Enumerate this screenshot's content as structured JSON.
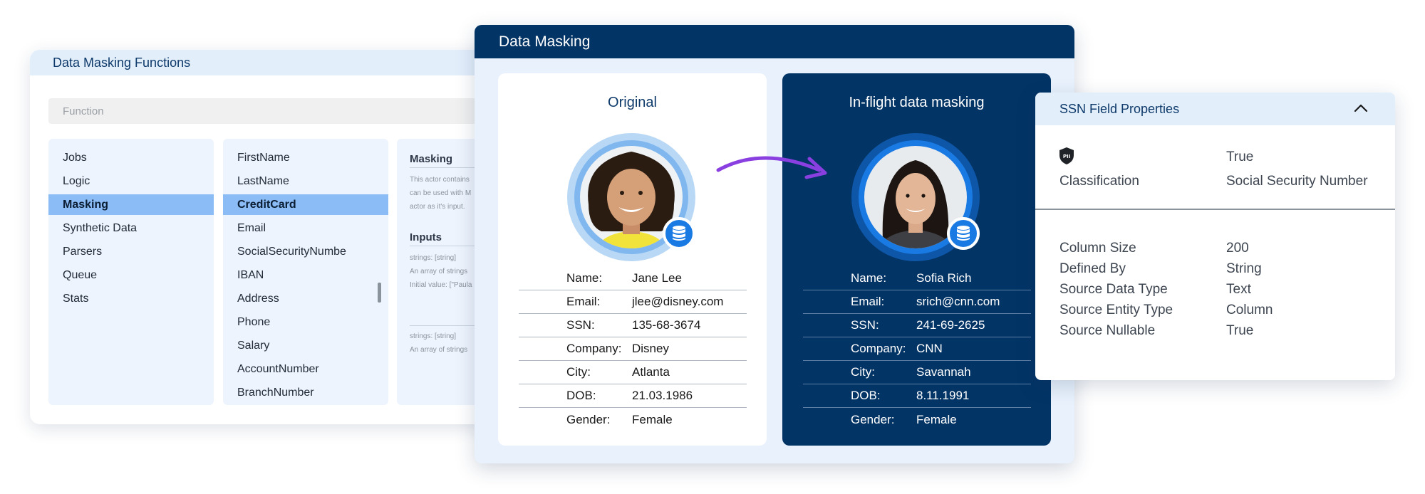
{
  "functions_panel": {
    "title": "Data Masking Functions",
    "search_placeholder": "Function",
    "categories": [
      "Jobs",
      "Logic",
      "Masking",
      "Synthetic Data",
      "Parsers",
      "Queue",
      "Stats"
    ],
    "selected_category": "Masking",
    "functions": [
      "FirstName",
      "LastName",
      "CreditCard",
      "Email",
      "SocialSecurityNumbe",
      "IBAN",
      "Address",
      "Phone",
      "Salary",
      "AccountNumber",
      "BranchNumber"
    ],
    "selected_function": "CreditCard",
    "detail": {
      "title": "Masking",
      "description_lines": [
        "This actor contains",
        "can be used with M",
        "actor as it's input."
      ],
      "inputs_title": "Inputs",
      "input1_lines": [
        "strings: [string]",
        "An array of strings",
        "Initial value: [\"Paula"
      ],
      "input2_lines": [
        "strings: [string]",
        "An array of strings"
      ]
    }
  },
  "masking_panel": {
    "title": "Data Masking",
    "original": {
      "title": "Original",
      "fields": [
        {
          "label": "Name:",
          "value": "Jane Lee"
        },
        {
          "label": "Email:",
          "value": "jlee@disney.com"
        },
        {
          "label": "SSN:",
          "value": "135-68-3674"
        },
        {
          "label": "Company:",
          "value": "Disney"
        },
        {
          "label": "City:",
          "value": "Atlanta"
        },
        {
          "label": "DOB:",
          "value": "21.03.1986"
        },
        {
          "label": "Gender:",
          "value": "Female"
        }
      ]
    },
    "masked": {
      "title": "In-flight data masking",
      "fields": [
        {
          "label": "Name:",
          "value": "Sofia Rich"
        },
        {
          "label": "Email:",
          "value": "srich@cnn.com"
        },
        {
          "label": "SSN:",
          "value": "241-69-2625"
        },
        {
          "label": "Company:",
          "value": "CNN"
        },
        {
          "label": "City:",
          "value": "Savannah"
        },
        {
          "label": "DOB:",
          "value": "8.11.1991"
        },
        {
          "label": "Gender:",
          "value": "Female"
        }
      ]
    }
  },
  "ssn_panel": {
    "title": "SSN Field Properties",
    "pii_value": "True",
    "pii_icon_text": "PII",
    "classification_label": "Classification",
    "classification_value": "Social Security Number",
    "properties": [
      {
        "key": "Column Size",
        "value": "200"
      },
      {
        "key": "Defined By",
        "value": "String"
      },
      {
        "key": "Source Data Type",
        "value": "Text"
      },
      {
        "key": "Source Entity Type",
        "value": "Column"
      },
      {
        "key": "Source Nullable",
        "value": "True"
      }
    ]
  },
  "colors": {
    "navy": "#033466",
    "accent_blue": "#1a7ae3",
    "arrow_purple": "#8a3fe0",
    "selection_blue": "#8bbcf5"
  }
}
